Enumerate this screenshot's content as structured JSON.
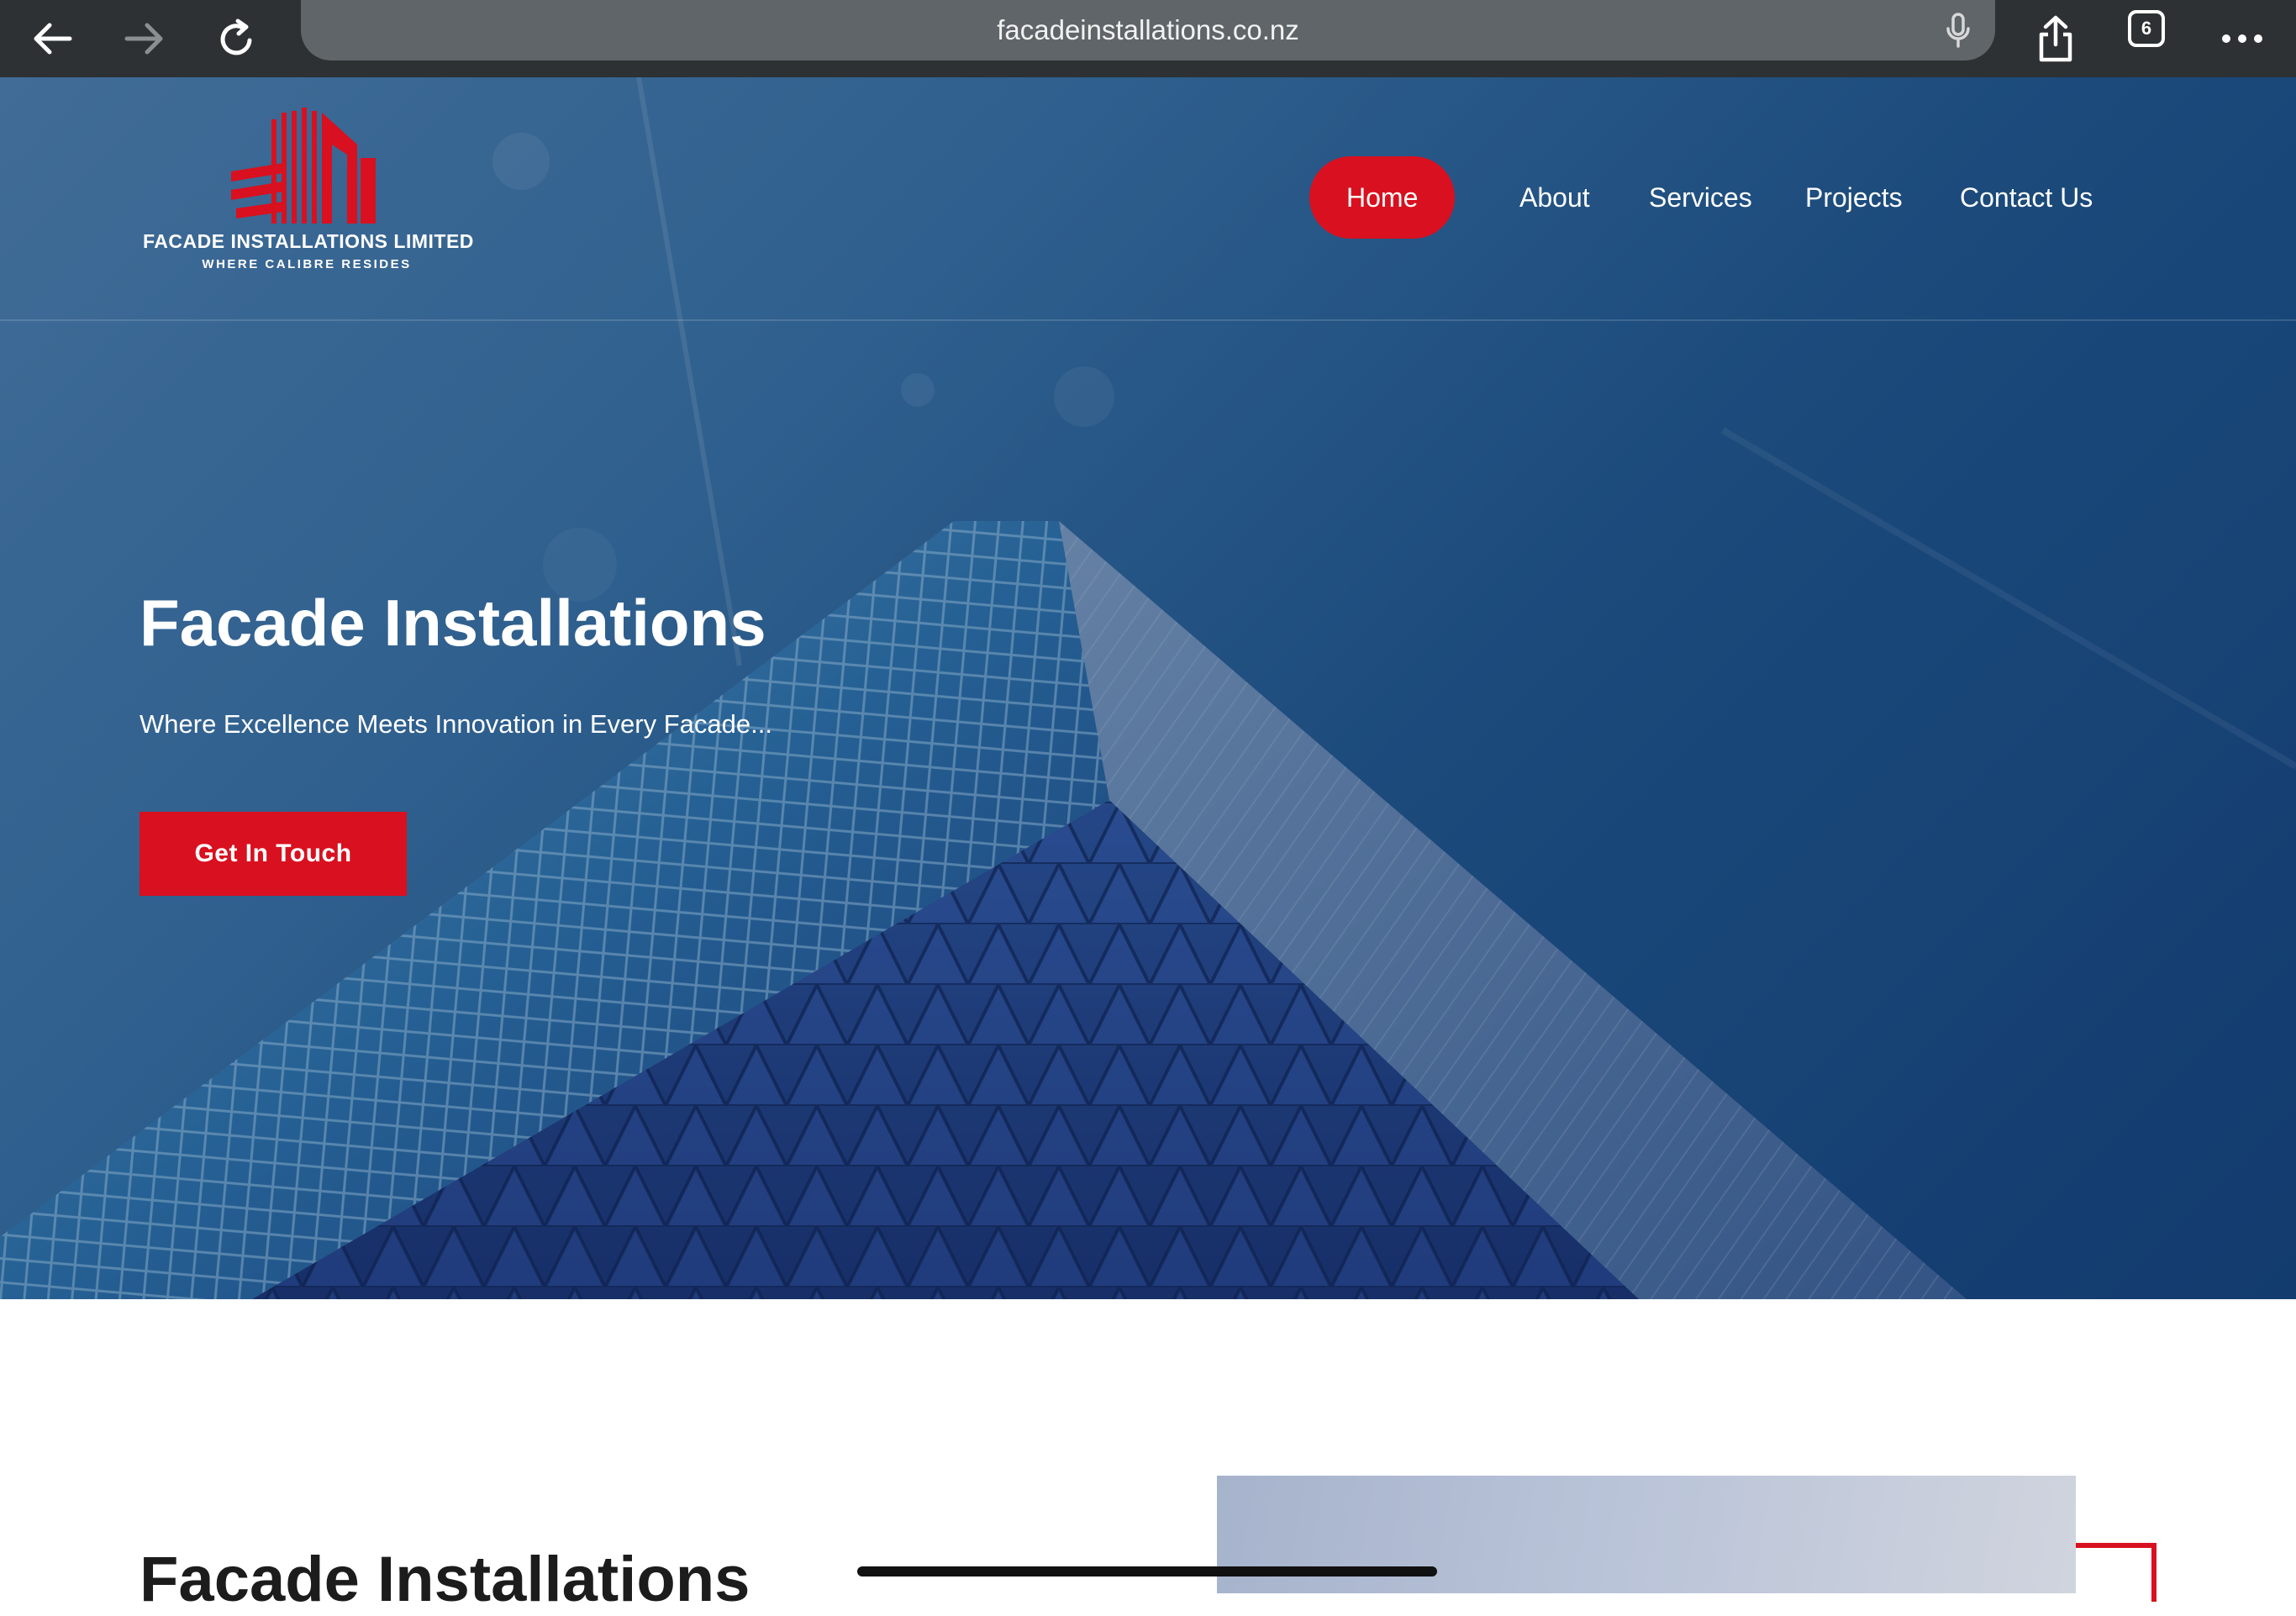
{
  "browser": {
    "url": "facadeinstallations.co.nz",
    "tab_count": "6"
  },
  "site": {
    "logo_name": "FACADE INSTALLATIONS LIMITED",
    "logo_tagline": "WHERE CALIBRE RESIDES",
    "nav": [
      "Home",
      "About",
      "Services",
      "Projects",
      "Contact Us"
    ],
    "active_nav": "Home"
  },
  "hero": {
    "title": "Facade Installations",
    "subtitle": "Where Excellence Meets Innovation in Every Facade...",
    "cta_label": "Get In Touch"
  },
  "section2": {
    "title": "Facade Installations"
  },
  "colors": {
    "brand_red": "#d9101f",
    "chrome_bg": "#2d3133",
    "hero_blue": "#1f5283"
  }
}
